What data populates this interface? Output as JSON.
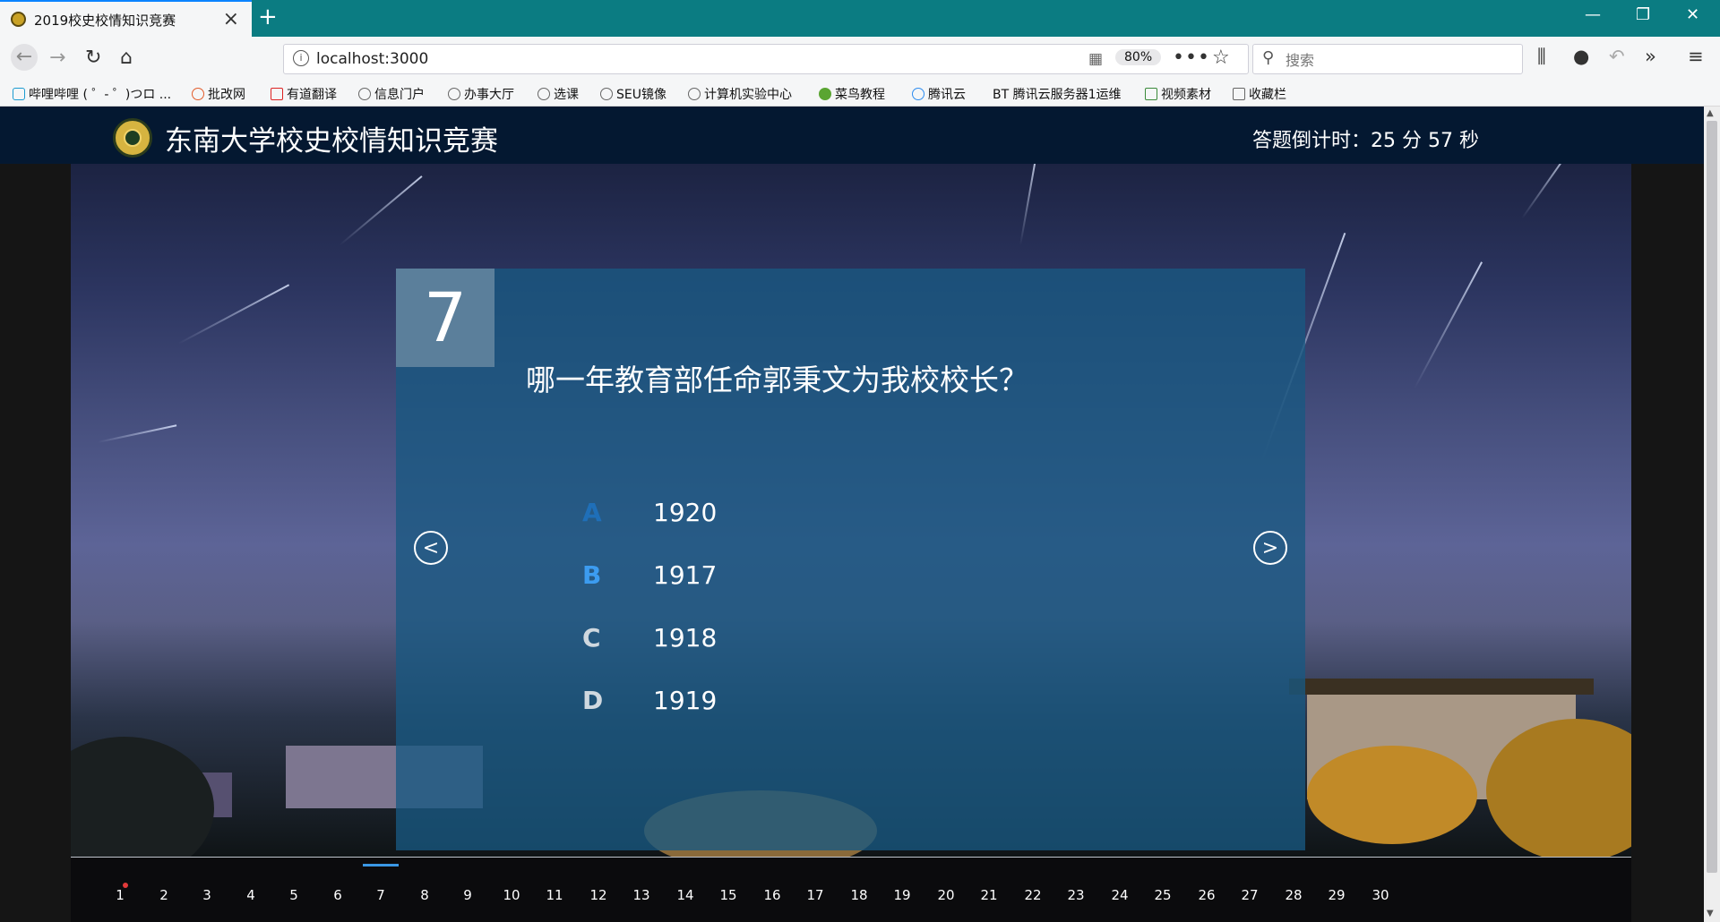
{
  "browser": {
    "tab_title": "2019校史校情知识竞赛",
    "new_tab": "+",
    "url": "localhost:3000",
    "zoom": "80%",
    "search_placeholder": "搜索",
    "bookmarks": [
      "哔哩哔哩 ( ゜- ゜)つロ ...",
      "批改网",
      "有道翻译",
      "信息门户",
      "办事大厅",
      "选课",
      "SEU镜像",
      "计算机实验中心",
      "菜鸟教程",
      "腾讯云",
      "BT 腾讯云服务器1运维",
      "视频素材",
      "收藏栏"
    ]
  },
  "header": {
    "title": "东南大学校史校情知识竞赛",
    "countdown": "答题倒计时：25 分 57 秒"
  },
  "question": {
    "number": "7",
    "text": "哪一年教育部任命郭秉文为我校校长？",
    "options": [
      {
        "letter": "A",
        "value": "1920"
      },
      {
        "letter": "B",
        "value": "1917"
      },
      {
        "letter": "C",
        "value": "1918"
      },
      {
        "letter": "D",
        "value": "1919"
      }
    ],
    "prev": "<",
    "next": ">"
  },
  "pager": {
    "pages": [
      "1",
      "2",
      "3",
      "4",
      "5",
      "6",
      "7",
      "8",
      "9",
      "10",
      "11",
      "12",
      "13",
      "14",
      "15",
      "16",
      "17",
      "18",
      "19",
      "20",
      "21",
      "22",
      "23",
      "24",
      "25",
      "26",
      "27",
      "28",
      "29",
      "30"
    ],
    "current": "7"
  },
  "colors": {
    "tabbar": "#0b7c82",
    "header_bg": "#041831",
    "card_bg": "#185882",
    "option_a": "#1f6fb8",
    "option_b": "#3c9cf0",
    "active_page": "#3a97e4",
    "dot": "#e23a3a"
  }
}
